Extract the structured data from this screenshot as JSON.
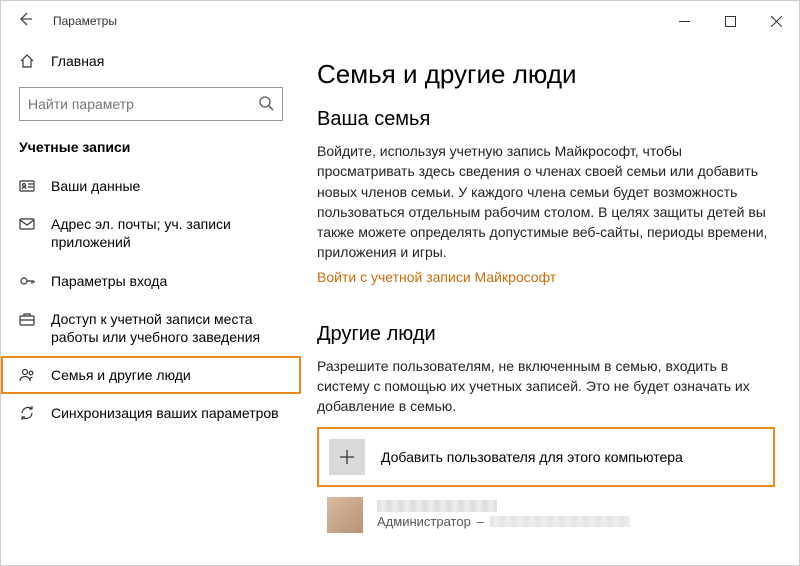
{
  "titlebar": {
    "title": "Параметры"
  },
  "sidebar": {
    "home_label": "Главная",
    "search_placeholder": "Найти параметр",
    "section_header": "Учетные записи",
    "items": [
      {
        "label": "Ваши данные"
      },
      {
        "label": "Адрес эл. почты; уч. записи приложений"
      },
      {
        "label": "Параметры входа"
      },
      {
        "label": "Доступ к учетной записи места работы или учебного заведения"
      },
      {
        "label": "Семья и другие люди"
      },
      {
        "label": "Синхронизация ваших параметров"
      }
    ]
  },
  "main": {
    "title": "Семья и другие люди",
    "family_header": "Ваша семья",
    "family_body": "Войдите, используя учетную запись Майкрософт, чтобы просматривать здесь сведения о членах своей семьи или добавить новых членов семьи. У каждого члена семьи будет возможность пользоваться отдельным рабочим столом. В целях защиты детей вы также можете определять допустимые веб-сайты, периоды времени, приложения и игры.",
    "signin_link": "Войти с учетной записи Майкрософт",
    "others_header": "Другие люди",
    "others_body": "Разрешите пользователям, не включенным в семью, входить в систему с помощью их учетных записей. Это не будет означать их добавление в семью.",
    "add_user_label": "Добавить пользователя для этого компьютера",
    "user_role": "Администратор",
    "user_role_separator": "–"
  },
  "colors": {
    "highlight_border": "#e88a1c",
    "link": "#cc6b0a"
  }
}
